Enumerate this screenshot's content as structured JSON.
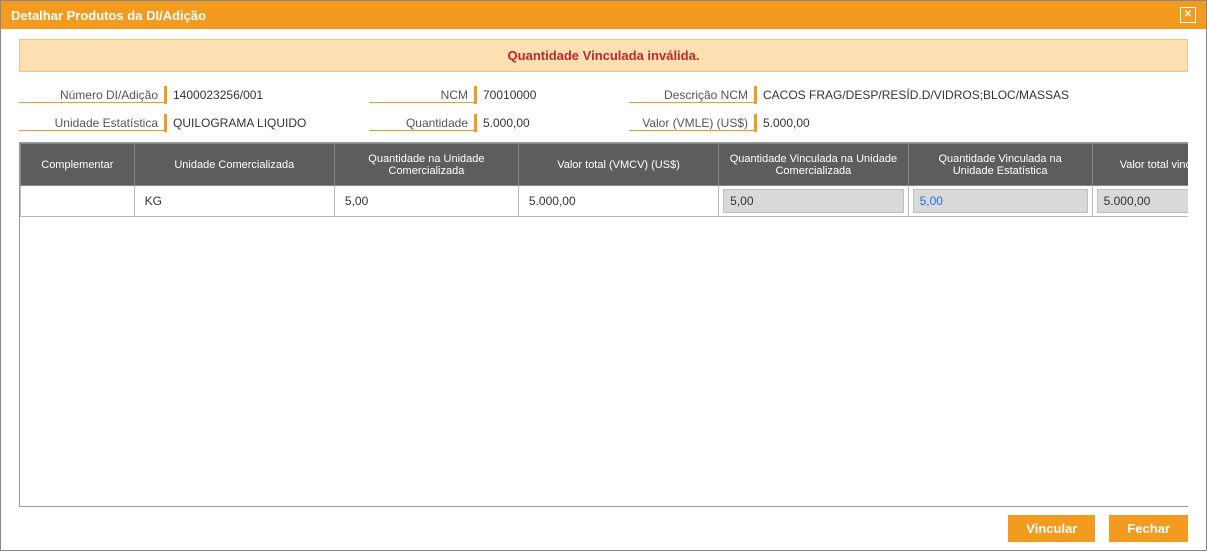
{
  "title": "Detalhar Produtos da DI/Adição",
  "alert": "Quantidade Vinculada inválida.",
  "fields": {
    "numero_label": "Número DI/Adição",
    "numero_value": "1400023256/001",
    "ncm_label": "NCM",
    "ncm_value": "70010000",
    "descncm_label": "Descrição NCM",
    "descncm_value": "CACOS FRAG/DESP/RESÍD.D/VIDROS;BLOC/MASSAS",
    "unidade_label": "Unidade Estatística",
    "unidade_value": "QUILOGRAMA LIQUIDO",
    "quantidade_label": "Quantidade",
    "quantidade_value": "5.000,00",
    "valor_label": "Valor (VMLE) (US$)",
    "valor_value": "5.000,00"
  },
  "table": {
    "headers": {
      "h0": "Complementar",
      "h1": "Unidade Comercializada",
      "h2": "Quantidade na Unidade Comercializada",
      "h3": "Valor total (VMCV) (US$)",
      "h4": "Quantidade Vinculada na Unidade Comercializada",
      "h5": "Quantidade Vinculada na Unidade Estatística",
      "h6": "Valor total vinculado (VMCV) (US$)"
    },
    "row": {
      "c0": "",
      "c1": "KG",
      "c2": "5,00",
      "c3": "5.000,00",
      "c4": "5,00",
      "c5": "5,00",
      "c6": "5.000,00"
    }
  },
  "buttons": {
    "vincular": "Vincular",
    "fechar": "Fechar"
  }
}
